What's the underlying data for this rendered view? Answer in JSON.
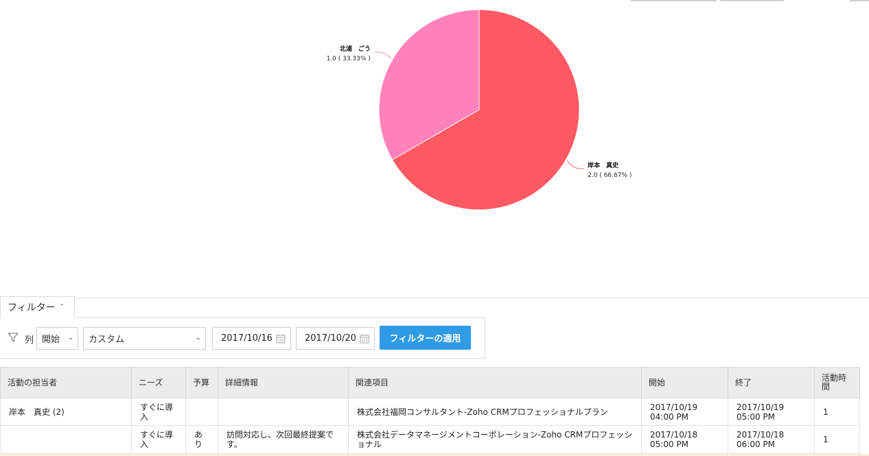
{
  "chart_data": {
    "type": "pie",
    "slices": [
      {
        "label": "岸本　真史",
        "value": 2.0,
        "value_label": "2.0 ( 66.67% )",
        "color": "#ff5964"
      },
      {
        "label": "北浦　ごう",
        "value": 1.0,
        "value_label": "1.0 ( 33.33% )",
        "color": "#ff82bb"
      }
    ]
  },
  "filter": {
    "tab_label": "フィルター",
    "column_label": "列",
    "field_select": "開始",
    "range_select": "カスタム",
    "date_from": "2017/10/16",
    "date_to": "2017/10/20",
    "apply_label": "フィルターの適用"
  },
  "table": {
    "headers": {
      "owner": "活動の担当者",
      "needs": "ニーズ",
      "budget": "予算",
      "details": "詳細情報",
      "related": "関連項目",
      "start": "開始",
      "end": "終了",
      "duration": "活動時間"
    },
    "rows": [
      {
        "owner": "岸本　真史 (2)",
        "needs": "すぐに導入",
        "budget": "",
        "details": "",
        "related": "株式会社福岡コンサルタント-Zoho CRMプロフェッショナルプラン",
        "start": "2017/10/19 04:00 PM",
        "end": "2017/10/19 05:00 PM",
        "duration": "1"
      },
      {
        "owner": "",
        "needs": "すぐに導入",
        "budget": "あり",
        "details": "訪問対応し、次回最終提案です。",
        "related": "株式会社データマネージメントコーポレーション-Zoho CRMプロフェッショナル",
        "start": "2017/10/18 05:00 PM",
        "end": "2017/10/18 06:00 PM",
        "duration": "1"
      }
    ]
  }
}
